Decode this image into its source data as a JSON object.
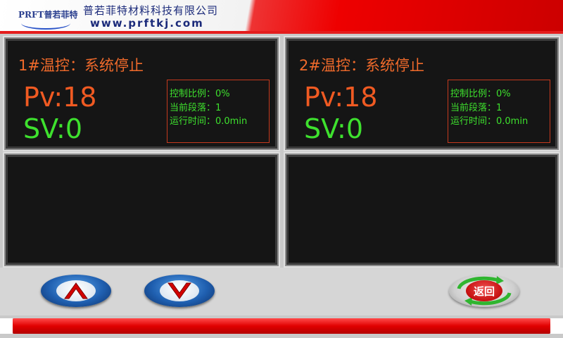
{
  "header": {
    "logo_text": "PRFT普若菲特",
    "company_name": "普若菲特材料科技有限公司",
    "website": "www.prftkj.com"
  },
  "panels": [
    {
      "title": "1#温控：系统停止",
      "pv": "Pv:18",
      "sv": "SV:0",
      "info": {
        "control_ratio": "控制比例：0%",
        "current_segment": "当前段落：1",
        "run_time": "运行时间：0.0min"
      }
    },
    {
      "title": "2#温控：系统停止",
      "pv": "Pv:18",
      "sv": "SV:0",
      "info": {
        "control_ratio": "控制比例：0%",
        "current_segment": "当前段落：1",
        "run_time": "运行时间：0.0min"
      }
    }
  ],
  "buttons": {
    "up_icon": "chevron-up-icon",
    "down_icon": "chevron-down-icon",
    "back_label": "返回"
  },
  "colors": {
    "pv": "#f05a22",
    "sv": "#3ee12e",
    "title": "#f06a2b",
    "accent_red": "#e10000",
    "button_blue": "#1f5fb0"
  }
}
